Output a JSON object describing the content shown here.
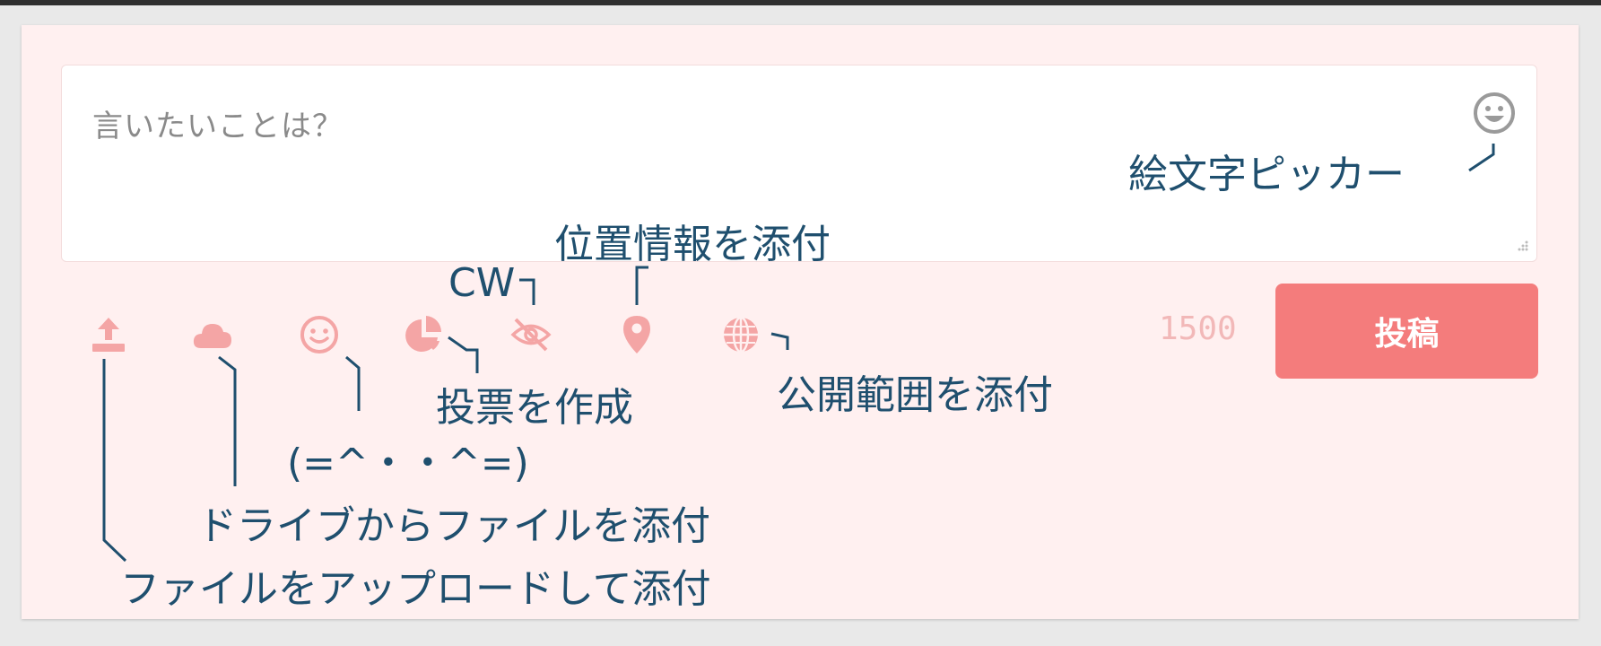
{
  "composer": {
    "placeholder": "言いたいことは？",
    "char_counter": "1500",
    "post_label": "投稿"
  },
  "toolbar_icons": [
    {
      "name": "upload-icon",
      "label": "ファイルをアップロードして添付"
    },
    {
      "name": "cloud-icon",
      "label": "ドライブからファイルを添付"
    },
    {
      "name": "smile-icon",
      "label": "(=^・・^=)"
    },
    {
      "name": "pie-chart-icon",
      "label": "投票を作成"
    },
    {
      "name": "eye-slash-icon",
      "label": "CW"
    },
    {
      "name": "map-pin-icon",
      "label": "位置情報を添付"
    },
    {
      "name": "globe-icon",
      "label": "公開範囲を添付"
    }
  ],
  "annotations": {
    "emoji_picker": "絵文字ピッカー",
    "location": "位置情報を添付",
    "cw": "CW",
    "poll": "投票を作成",
    "visibility": "公開範囲を添付",
    "cat": "(=^・・^=)",
    "drive": "ドライブからファイルを添付",
    "upload": "ファイルをアップロードして添付"
  },
  "colors": {
    "accent": "#f47c7c",
    "icon": "#f4a5a5",
    "panel_bg": "#fff0f0",
    "annotation": "#1f4f6e"
  }
}
